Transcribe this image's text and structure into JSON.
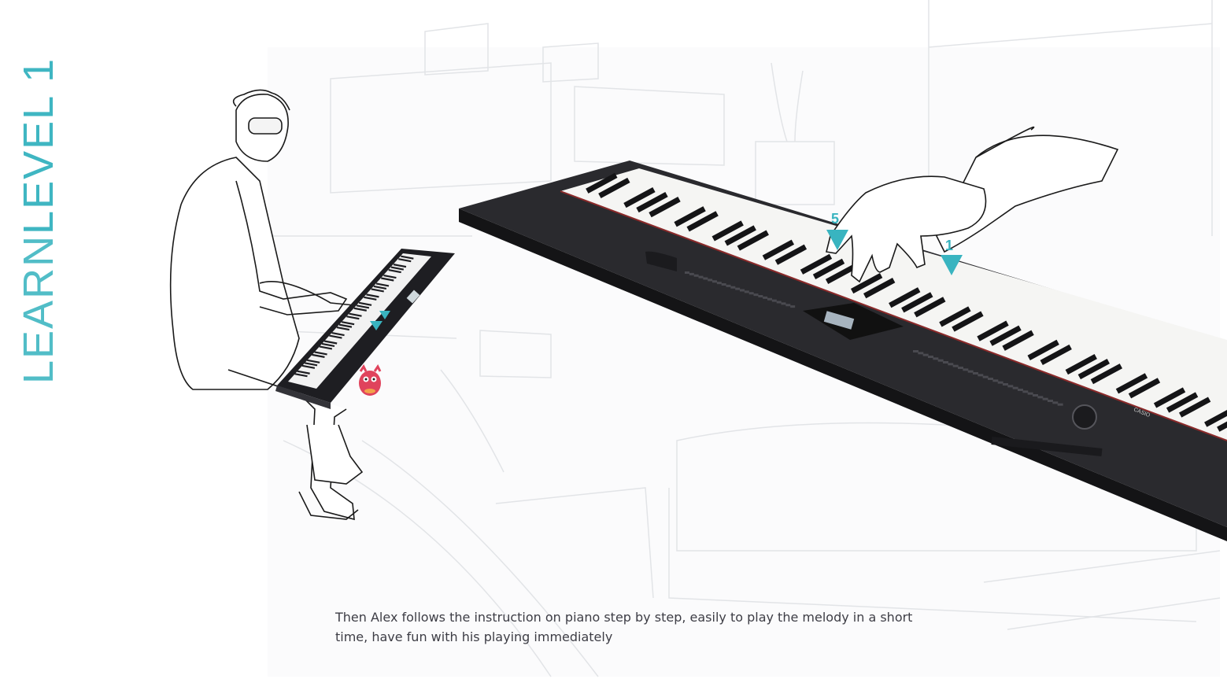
{
  "heading": {
    "prefix": "LEARN",
    "main": "LEVEL 1"
  },
  "caption": "Then Alex follows the instruction on piano step by step, easily to play the melody in a short time, have fun with his playing immediately",
  "finger_markers": [
    "5",
    "1"
  ],
  "brand_text": "CASIO",
  "colors": {
    "accent": "#3fb6c2",
    "keyboard_body": "#26262a",
    "sketch_line": "#d6d8dc",
    "caption_text": "#3d3d45"
  }
}
